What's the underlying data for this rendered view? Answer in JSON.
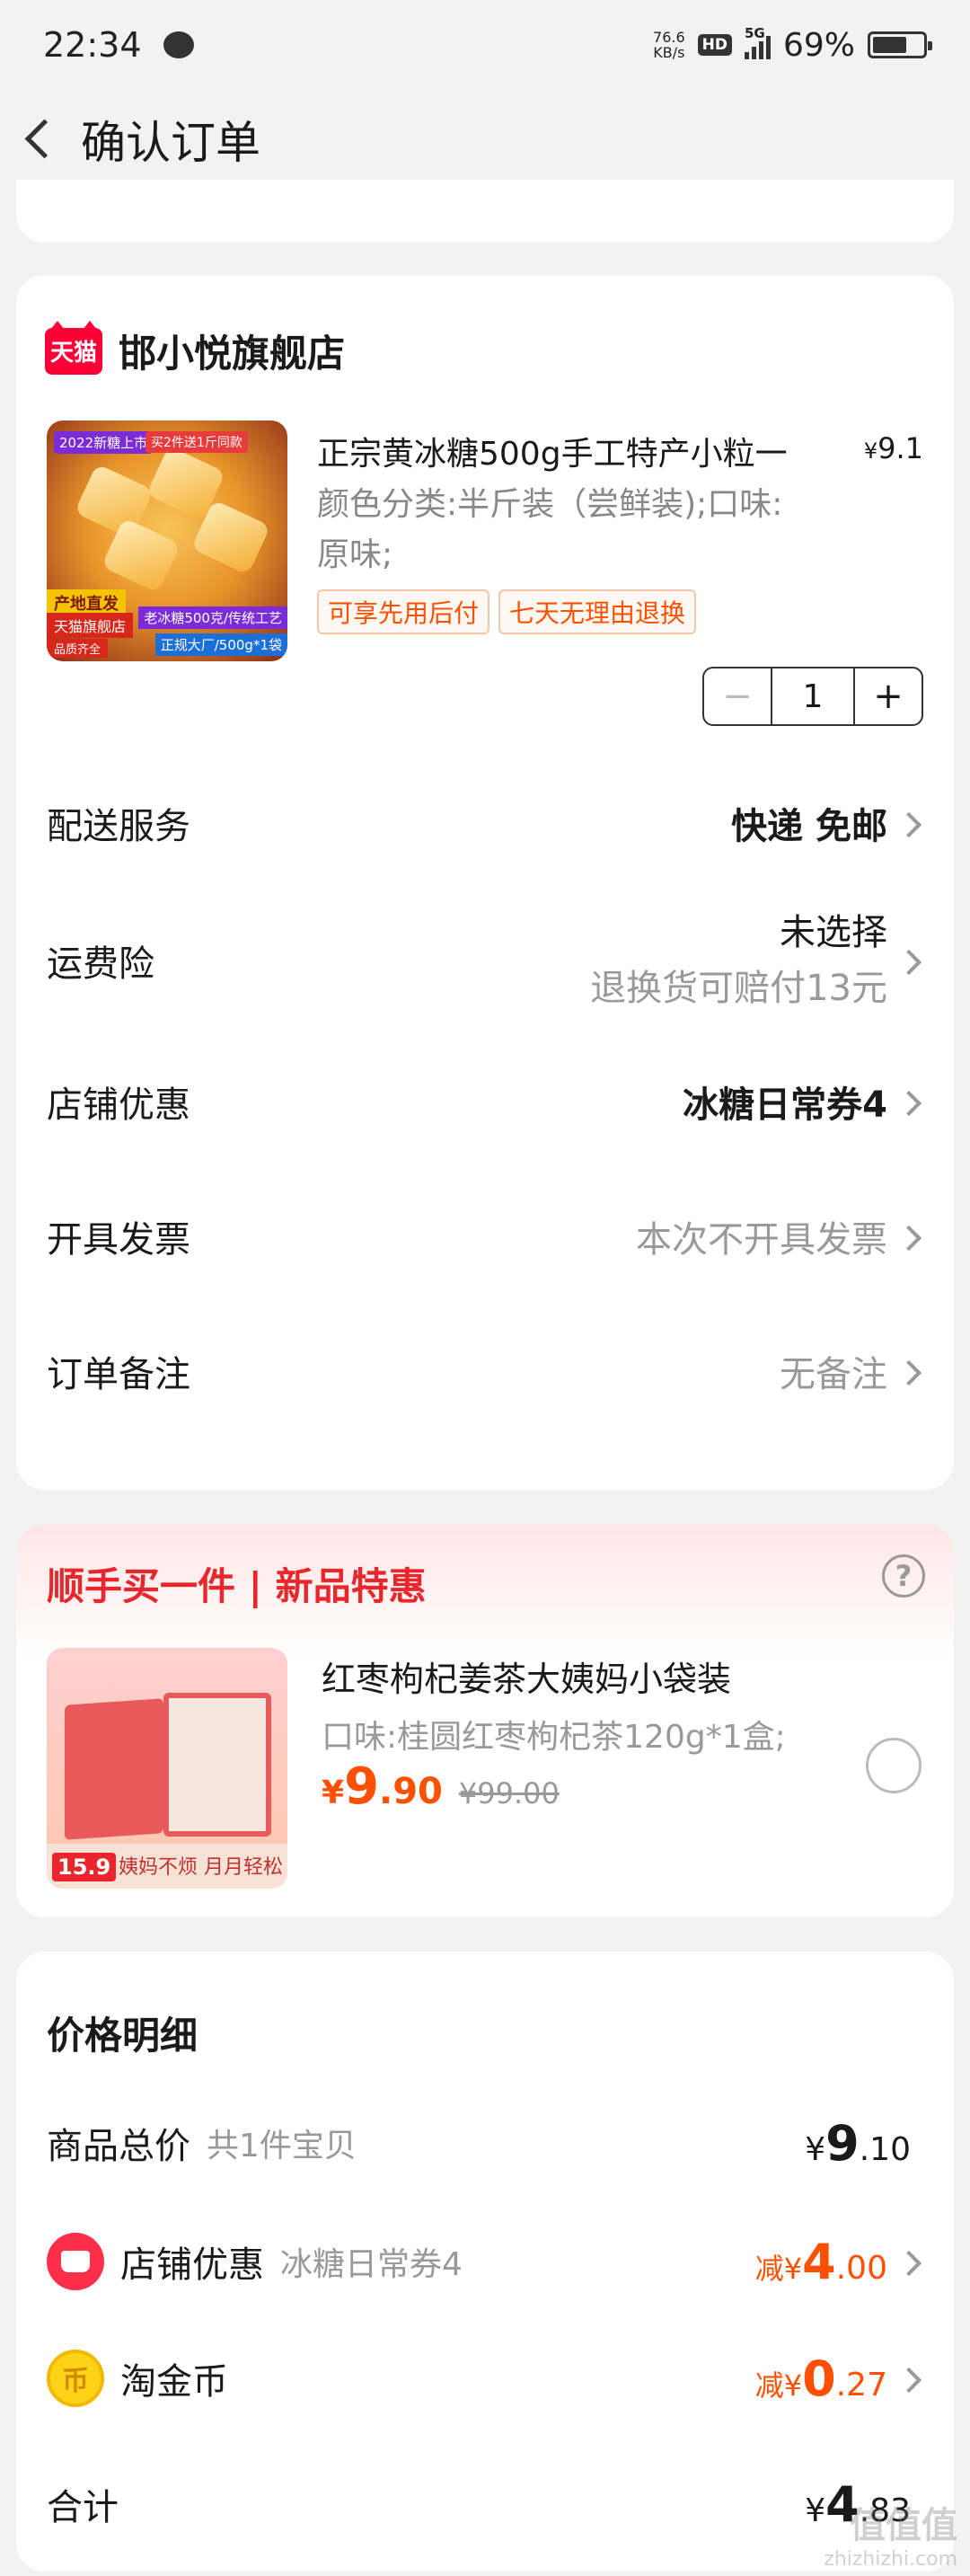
{
  "status": {
    "time": "22:34",
    "netspeed_value": "76.6",
    "netspeed_unit": "KB/s",
    "hd": "HD",
    "network": "5G",
    "battery": "69%"
  },
  "header": {
    "title": "确认订单"
  },
  "shop": {
    "name": "邯小悦旗舰店",
    "logo_text": "天猫",
    "product": {
      "title": "正宗黄冰糖500g手工特产小粒一",
      "price_symbol": "¥",
      "price": "9.1",
      "spec": "颜色分类:半斤装（尝鲜装);口味:原味;",
      "tags": [
        "可享先用后付",
        "七天无理由退换"
      ],
      "quantity": "1",
      "image_tags": {
        "t1": "2022新糖上市",
        "t2": "买2件送1斤同款",
        "b1": "产地直发",
        "b2": "天猫旗舰店",
        "b3": "品质齐全",
        "b4": "老冰糖500克/传统工艺",
        "b5": "正规大厂/500g*1袋"
      }
    },
    "rows": [
      {
        "label": "配送服务",
        "value": "快递 免邮"
      },
      {
        "label": "运费险",
        "value": "未选择",
        "subvalue": "退换货可赔付13元"
      },
      {
        "label": "店铺优惠",
        "value": "冰糖日常券4"
      },
      {
        "label": "开具发票",
        "value": "本次不开具发票"
      },
      {
        "label": "订单备注",
        "value": "无备注"
      }
    ]
  },
  "promo": {
    "title": "顺手买一件 | 新品特惠",
    "help": "?",
    "name": "红枣枸杞姜茶大姨妈小袋装",
    "spec": "口味:桂圆红枣枸杞茶120g*1盒;",
    "price_symbol": "¥",
    "price_int": "9",
    "price_dec": ".90",
    "old_price": "¥99.00",
    "image_price": "15.9",
    "image_slogan": "姨妈不烦  月月轻松"
  },
  "price_detail": {
    "title": "价格明细",
    "total_label": "商品总价",
    "total_sub": "共1件宝贝",
    "total_symbol": "¥",
    "total_int": "9",
    "total_dec": ".10",
    "shop_discount_label": "店铺优惠",
    "shop_discount_sub": "冰糖日常券4",
    "shop_discount_prefix": "减¥",
    "shop_discount_int": "4",
    "shop_discount_dec": ".00",
    "coin_label": "淘金币",
    "coin_prefix": "减¥",
    "coin_int": "0",
    "coin_dec": ".27",
    "sum_label": "合计",
    "sum_symbol": "¥",
    "sum_int": "4",
    "sum_dec": ".83"
  },
  "watermark": {
    "line1": "值值值",
    "line2": "zhizhizhi.com"
  },
  "colors": {
    "accent": "#ff5000",
    "promo_red": "#e8262b",
    "tmall_red": "#ff0036"
  }
}
